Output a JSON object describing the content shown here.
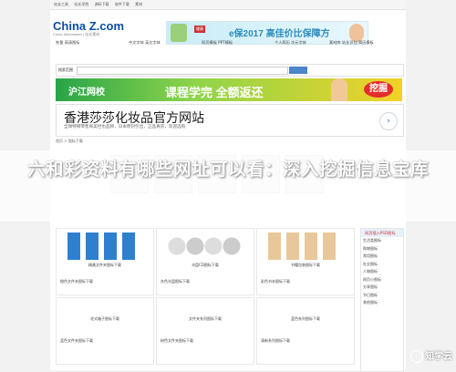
{
  "topbar": {
    "items": [
      "站长工具",
      "站长学院",
      "源码下载",
      "软件下载",
      "素材"
    ]
  },
  "logo": {
    "text": "China Z.com",
    "sub": "China Webmaster | 站长素材"
  },
  "top_ad": {
    "text": "e保2017 高佳价比保障方",
    "tag": "健康"
  },
  "nav": {
    "cols": [
      "矢量  高清图标",
      "中文字体  英文字体",
      "网页模板  PPT模板",
      "个人简历  次元字体",
      "素材库  站长识别  简历模板"
    ]
  },
  "search": {
    "label": "搜索范围"
  },
  "banner1": {
    "brand": "沪江网校",
    "text": "课程学完 全额返还",
    "cta": "挖掘"
  },
  "banner2": {
    "heading": "香港莎莎化妆品官方网站",
    "sub": "全球特销零售商美世也品牌，日本原封引出，正品真货，欢迎选购",
    "go": "›"
  },
  "crumb": "首页 > 图标下载",
  "cells": [
    {
      "cap": "精美文件夹图标下载",
      "sub": "橙色文件夹图标下载"
    },
    {
      "cap": "光盘CD图标下载",
      "sub": "灰色光盘图标下载"
    },
    {
      "cap": "书籍包装图标下载",
      "sub": "彩色书本图标下载"
    },
    {
      "cap": "花式箱子图标下载",
      "sub": "蓝色文件夹图标下载"
    },
    {
      "cap": "文件夹系列图标下载",
      "sub": "粉色文件夹图标下载"
    },
    {
      "cap": "蓝色系列图标下载",
      "sub": "清新系列图标下载"
    }
  ],
  "sidebar": {
    "head": "网页插入PSD图标",
    "items": [
      "生活类图标",
      "购物图标",
      "常用图标",
      "社交图标",
      "人物图标",
      "网页小图标",
      "分享图标",
      "节日图标",
      "其他图标"
    ]
  },
  "overlay_title": "六和彩资料有哪些网址可以看：深入挖掘信息宝库",
  "watermark": "知学云"
}
